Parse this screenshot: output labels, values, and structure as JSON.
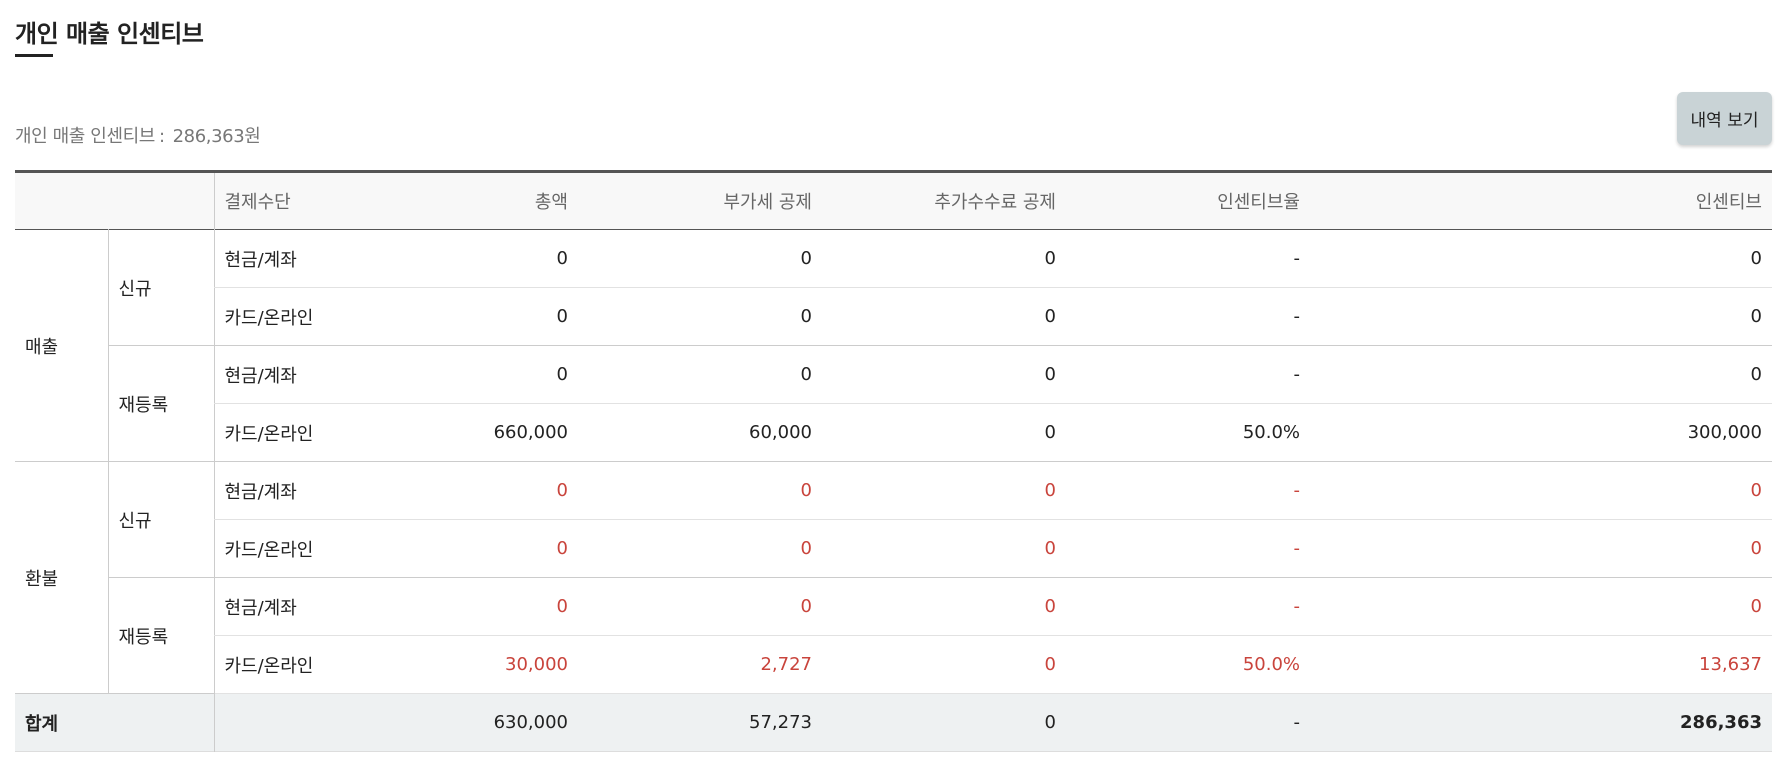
{
  "page": {
    "title": "개인 매출 인센티브",
    "summary_label": "개인 매출 인센티브",
    "summary_sep": ":",
    "summary_value": "286,363원",
    "history_button": "내역 보기"
  },
  "table": {
    "headers": [
      "결제수단",
      "총액",
      "부가세 공제",
      "추가수수료 공제",
      "인센티브율",
      "인센티브"
    ],
    "sections": [
      {
        "category": "매출",
        "groups": [
          {
            "sub": "신규",
            "rows": [
              {
                "method": "현금/계좌",
                "total": "0",
                "vat": "0",
                "fee": "0",
                "rate": "-",
                "incentive": "0"
              },
              {
                "method": "카드/온라인",
                "total": "0",
                "vat": "0",
                "fee": "0",
                "rate": "-",
                "incentive": "0"
              }
            ]
          },
          {
            "sub": "재등록",
            "rows": [
              {
                "method": "현금/계좌",
                "total": "0",
                "vat": "0",
                "fee": "0",
                "rate": "-",
                "incentive": "0"
              },
              {
                "method": "카드/온라인",
                "total": "660,000",
                "vat": "60,000",
                "fee": "0",
                "rate": "50.0%",
                "incentive": "300,000"
              }
            ]
          }
        ]
      },
      {
        "category": "환불",
        "groups": [
          {
            "sub": "신규",
            "rows": [
              {
                "method": "현금/계좌",
                "total": "0",
                "vat": "0",
                "fee": "0",
                "rate": "-",
                "incentive": "0"
              },
              {
                "method": "카드/온라인",
                "total": "0",
                "vat": "0",
                "fee": "0",
                "rate": "-",
                "incentive": "0"
              }
            ]
          },
          {
            "sub": "재등록",
            "rows": [
              {
                "method": "현금/계좌",
                "total": "0",
                "vat": "0",
                "fee": "0",
                "rate": "-",
                "incentive": "0"
              },
              {
                "method": "카드/온라인",
                "total": "30,000",
                "vat": "2,727",
                "fee": "0",
                "rate": "50.0%",
                "incentive": "13,637"
              }
            ]
          }
        ]
      }
    ],
    "total": {
      "label": "합계",
      "total": "630,000",
      "vat": "57,273",
      "fee": "0",
      "rate": "-",
      "incentive": "286,363"
    }
  },
  "colors": {
    "refund": "#c9443c",
    "button_bg": "#c9d3d6",
    "total_row_bg": "#eef1f2"
  }
}
